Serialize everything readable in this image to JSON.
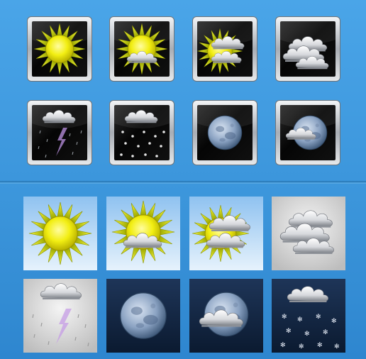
{
  "icon_sets": [
    {
      "name": "dark-framed",
      "icons": [
        "sun-icon",
        "sun-partly-cloudy-icon",
        "sun-mostly-cloudy-icon",
        "overcast-clouds-icon",
        "thunderstorm-rain-icon",
        "snow-cloud-icon",
        "full-moon-icon",
        "moon-partly-cloudy-icon"
      ]
    },
    {
      "name": "light-square",
      "icons": [
        "sun-icon",
        "sun-partly-cloudy-icon",
        "sun-mostly-cloudy-icon",
        "overcast-clouds-icon",
        "thunderstorm-rain-icon",
        "full-moon-icon",
        "moon-partly-cloudy-icon",
        "snow-cloud-night-icon"
      ]
    }
  ],
  "colors": {
    "sky_blue": "#3a93d8",
    "sun_yellow": "#f4f00a",
    "sun_ray": "#c8d400",
    "dark_tile": "#0a0a0a",
    "frame_silver": "#c8ccd2",
    "moon_blue": "#8ba6c6"
  }
}
